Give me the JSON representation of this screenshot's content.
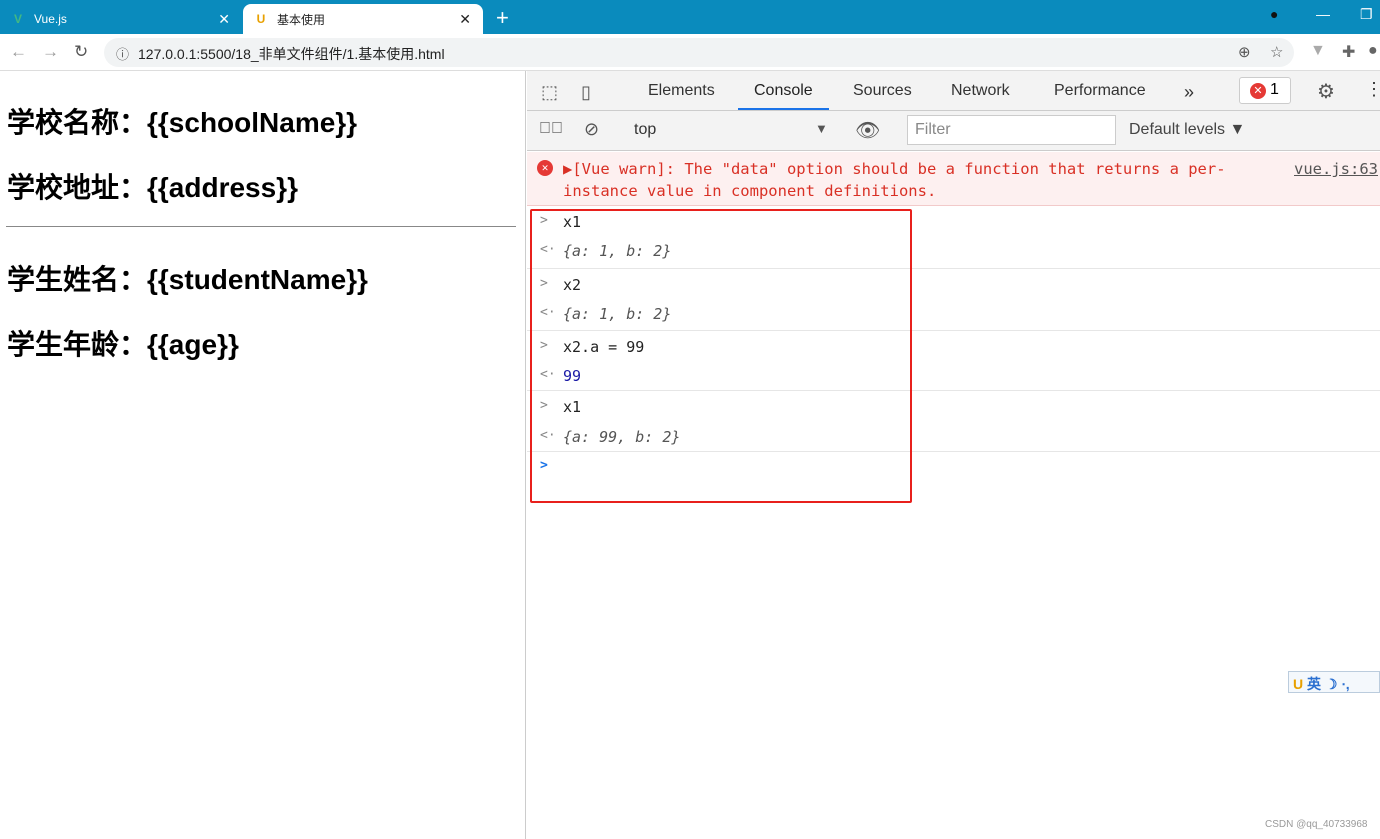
{
  "browser": {
    "tabs": [
      {
        "title": "Vue.js",
        "icon": "vue-logo-icon"
      },
      {
        "title": "基本使用",
        "icon": "u-logo-icon",
        "active": true
      }
    ],
    "url": "127.0.0.1:5500/18_非单文件组件/1.基本使用.html"
  },
  "page": {
    "lines": [
      "学校名称：{{schoolName}}",
      "学校地址：{{address}}",
      "学生姓名：{{studentName}}",
      "学生年龄：{{age}}"
    ]
  },
  "devtools": {
    "tabs": [
      "Elements",
      "Console",
      "Sources",
      "Network",
      "Performance"
    ],
    "active_tab": "Console",
    "error_count": "1",
    "context": "top",
    "filter_placeholder": "Filter",
    "levels": "Default levels ▼",
    "warning": {
      "text": "▶[Vue warn]: The \"data\" option should be a function that returns a per-instance value in component definitions.",
      "source": "vue.js:63"
    },
    "entries": [
      {
        "input": "x1",
        "output": "{a: 1, b: 2}"
      },
      {
        "input": "x2",
        "output": "{a: 1, b: 2}"
      },
      {
        "input": "x2.a = 99",
        "output": "99"
      },
      {
        "input": "x1",
        "output": "{a: 99, b: 2}"
      }
    ]
  },
  "ime": {
    "label": "英"
  },
  "watermark": "CSDN @qq_40733968",
  "colors": {
    "tabbar": "#0a8bbd",
    "error": "#d93025",
    "highlight_box": "#e8201c",
    "accent": "#1a73e8"
  }
}
